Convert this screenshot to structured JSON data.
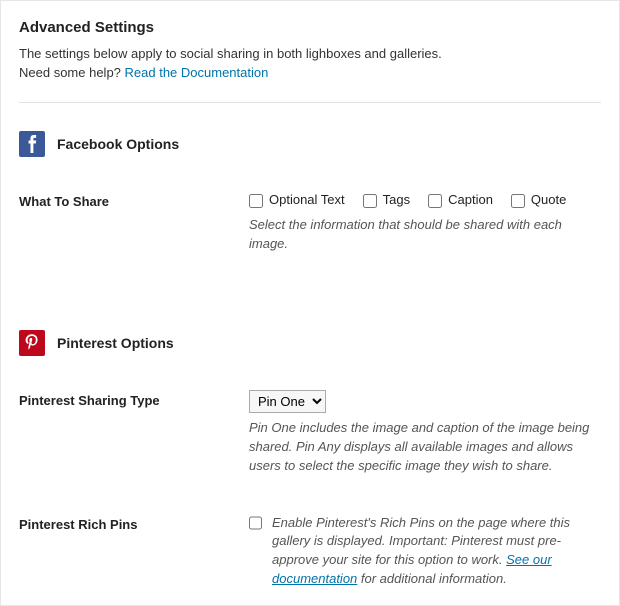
{
  "header": {
    "title": "Advanced Settings",
    "intro_text": "The settings below apply to social sharing in both lighboxes and galleries.",
    "intro_help_prefix": "Need some help? ",
    "intro_help_link": "Read the Documentation"
  },
  "facebook": {
    "section_title": "Facebook Options",
    "what_to_share": {
      "label": "What To Share",
      "options": {
        "optional_text": "Optional Text",
        "tags": "Tags",
        "caption": "Caption",
        "quote": "Quote"
      },
      "help": "Select the information that should be shared with each image."
    }
  },
  "pinterest": {
    "section_title": "Pinterest Options",
    "sharing_type": {
      "label": "Pinterest Sharing Type",
      "selected": "Pin One",
      "help": "Pin One includes the image and caption of the image being shared. Pin Any displays all available images and allows users to select the specific image they wish to share."
    },
    "rich_pins": {
      "label": "Pinterest Rich Pins",
      "help_part1": "Enable Pinterest's Rich Pins on the page where this gallery is displayed. Important: Pinterest must pre-approve your site for this option to work. ",
      "link": "See our documentation",
      "help_part2": " for additional information."
    }
  }
}
